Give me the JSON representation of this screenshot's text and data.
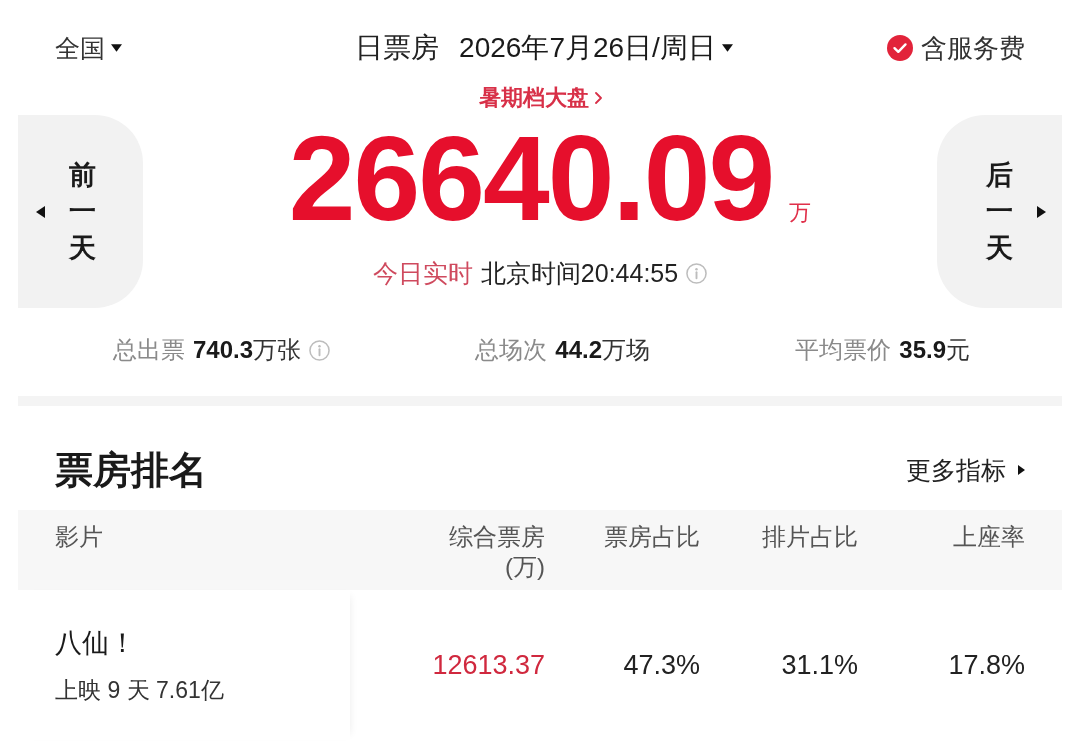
{
  "header": {
    "region": "全国",
    "title": "日票房",
    "date": "2026年7月26日/周日",
    "service_fee": {
      "label": "含服务费",
      "checked": true
    }
  },
  "season_link": "暑期档大盘",
  "total": {
    "value": "26640.09",
    "unit": "万"
  },
  "realtime": {
    "label": "今日实时",
    "time": "北京时间20:44:55"
  },
  "day_nav": {
    "previous": "前一天",
    "next": "后一天"
  },
  "stats": [
    {
      "label": "总出票",
      "value": "**740.3**万张",
      "info": true
    },
    {
      "label": "总场次",
      "value": "**44.2**万场",
      "info": false
    },
    {
      "label": "平均票价",
      "value": "**35.9**元",
      "info": false
    }
  ],
  "ranking": {
    "title": "票房排名",
    "more": "更多指标",
    "columns": [
      {
        "label": "影片"
      },
      {
        "label": "综合票房",
        "unit": "(万)"
      },
      {
        "label": "票房占比"
      },
      {
        "label": "排片占比"
      },
      {
        "label": "上座率"
      }
    ],
    "rows": [
      {
        "title": "八仙！",
        "subtitle": "上映 9 天 7.61亿",
        "box_office": "12613.37",
        "box_office_share": "47.3%",
        "screening_share": "31.1%",
        "occupancy": "17.8%"
      }
    ]
  }
}
